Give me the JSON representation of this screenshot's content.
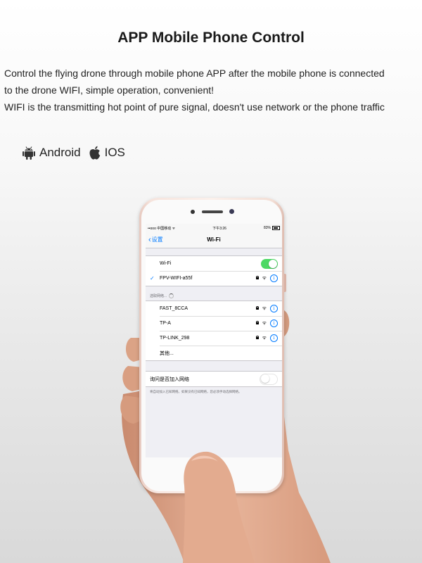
{
  "header": {
    "title": "APP Mobile Phone Control",
    "desc_line1": "Control the flying drone through mobile phone APP after the mobile phone is connected",
    "desc_line2": "to the drone WIFI, simple operation, convenient!",
    "desc_line3": "WIFI is the transmitting hot point of pure signal, doesn't use network or the phone traffic"
  },
  "platforms": [
    {
      "label": "Android",
      "icon": "android-icon"
    },
    {
      "label": "IOS",
      "icon": "apple-icon"
    }
  ],
  "phone": {
    "status_bar": {
      "carrier": "••ooo 中国移动 ᯤ",
      "time": "下午3:26",
      "battery": "83%"
    },
    "nav": {
      "back_label": "设置",
      "title": "Wi-Fi"
    },
    "wifi_toggle": {
      "label": "Wi-Fi",
      "state": "on"
    },
    "connected_network": "FPV-WIFI-a55f",
    "choose_network_label": "选取网络...",
    "networks": [
      {
        "name": "FAST_8CCA"
      },
      {
        "name": "TP-A"
      },
      {
        "name": "TP-LINK_298"
      }
    ],
    "other_label": "其他...",
    "ask_join": {
      "label": "询问是否加入网络",
      "state": "off"
    },
    "ask_join_note": "将自动加入已知网络。如果没有已知网络，您必须手动选择网络。"
  },
  "colors": {
    "accent": "#007aff",
    "toggle_on": "#4cd964",
    "phone_body": "#f3dfd6"
  }
}
